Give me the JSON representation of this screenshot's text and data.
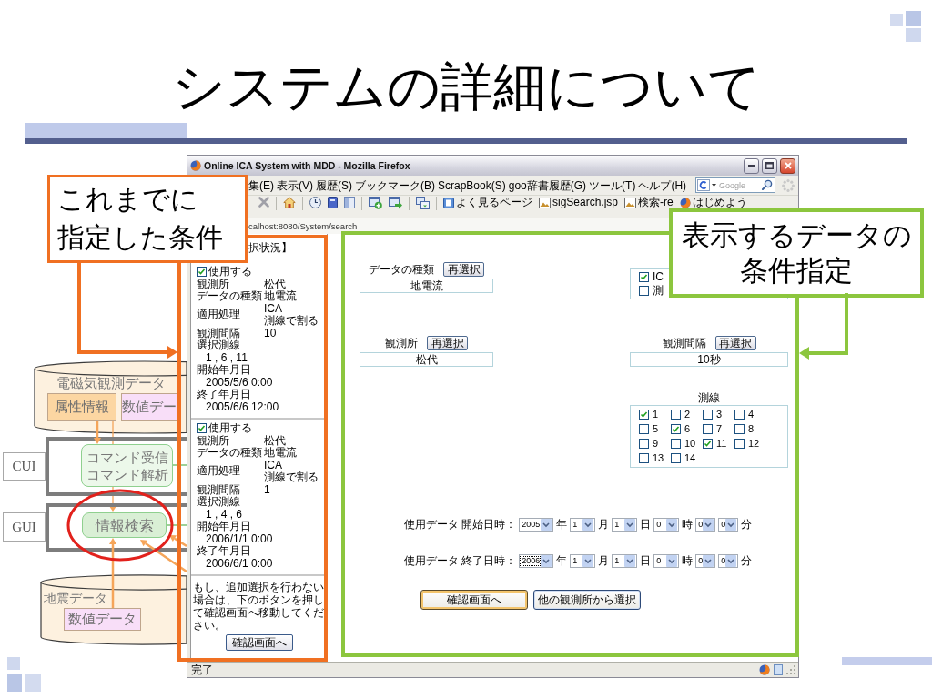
{
  "slide": {
    "title": "システムの詳細について"
  },
  "diagram": {
    "stores": [
      {
        "label": "電磁気観測データ",
        "blocks": [
          {
            "label": "属性情報",
            "color": "#fcd6a2"
          },
          {
            "label": "数値デー",
            "color": "#f8def8"
          }
        ]
      },
      {
        "label": "地震データ",
        "blocks": [
          {
            "label": "数値データ",
            "color": "#f8def8"
          }
        ]
      }
    ],
    "layers": [
      {
        "label": "CUI",
        "module": "コマンド受信コマンド解析",
        "circled": false
      },
      {
        "label": "GUI",
        "module": "情報検索",
        "circled": true
      }
    ]
  },
  "browser": {
    "title": "Online ICA System with MDD - Mozilla Firefox",
    "menu": [
      "集(E)",
      "表示(V)",
      "履歴(S)",
      "ブックマーク(B)",
      "ScrapBook(S)",
      "goo辞書履歴(G)",
      "ツール(T)",
      "ヘルプ(H)"
    ],
    "search": {
      "placeholder": "Google"
    },
    "bookmarks": [
      {
        "label": "よく見るページ",
        "kind": "page"
      },
      {
        "label": "sigSearch.jsp",
        "kind": "image"
      },
      {
        "label": "検索-re",
        "kind": "image"
      },
      {
        "label": "はじめよう",
        "kind": "globe"
      }
    ],
    "address": "calhost:8080/System/search",
    "status": "完了"
  },
  "selection_panel": {
    "header": "択状況】",
    "entries": [
      {
        "use_label": "使用する",
        "checked": true,
        "fields": [
          {
            "kind": "inline",
            "label": "観測所",
            "values": [
              "松代"
            ]
          },
          {
            "kind": "inline",
            "label": "データの種類",
            "values": [
              "地電流"
            ]
          },
          {
            "kind": "inline",
            "label": "適用処理",
            "values": [
              "ICA",
              "測線で割る"
            ]
          },
          {
            "kind": "inline",
            "label": "観測間隔",
            "values": [
              "10"
            ]
          },
          {
            "kind": "stacked",
            "label": "選択測線",
            "values": [
              "1 , 6 , 11"
            ]
          },
          {
            "kind": "stacked",
            "label": "開始年月日",
            "values": [
              "2005/5/6 0:00"
            ]
          },
          {
            "kind": "stacked",
            "label": "終了年月日",
            "values": [
              "2005/6/6 12:00"
            ]
          }
        ]
      },
      {
        "use_label": "使用する",
        "checked": true,
        "fields": [
          {
            "kind": "inline",
            "label": "観測所",
            "values": [
              "松代"
            ]
          },
          {
            "kind": "inline",
            "label": "データの種類",
            "values": [
              "地電流"
            ]
          },
          {
            "kind": "inline",
            "label": "適用処理",
            "values": [
              "ICA",
              "測線で割る"
            ]
          },
          {
            "kind": "inline",
            "label": "観測間隔",
            "values": [
              "1"
            ]
          },
          {
            "kind": "stacked",
            "label": "選択測線",
            "values": [
              "1 , 4 , 6"
            ]
          },
          {
            "kind": "stacked",
            "label": "開始年月日",
            "values": [
              "2006/1/1 0:00"
            ]
          },
          {
            "kind": "stacked",
            "label": "終了年月日",
            "values": [
              "2006/6/1 0:00"
            ]
          }
        ]
      }
    ],
    "note": "もし、追加選択を行わない場合は、下のボタンを押して確認画面へ移動してください。",
    "button": "確認画面へ"
  },
  "search_form": {
    "rows": [
      [
        {
          "kind": "field",
          "label": "データの種類",
          "button": "再選択",
          "value": "地電流"
        },
        {
          "kind": "checklist",
          "items": [
            {
              "label": "IC",
              "checked": true
            },
            {
              "label": "測",
              "checked": false
            }
          ]
        }
      ],
      [
        {
          "kind": "field",
          "label": "観測所",
          "button": "再選択",
          "value": "松代"
        },
        {
          "kind": "field",
          "label": "観測間隔",
          "button": "再選択",
          "value": "10秒"
        }
      ]
    ],
    "lines": {
      "label": "測線",
      "items": [
        {
          "label": "1",
          "checked": true
        },
        {
          "label": "2",
          "checked": false
        },
        {
          "label": "3",
          "checked": false
        },
        {
          "label": "4",
          "checked": false
        },
        {
          "label": "5",
          "checked": false
        },
        {
          "label": "6",
          "checked": true
        },
        {
          "label": "7",
          "checked": false
        },
        {
          "label": "8",
          "checked": false
        },
        {
          "label": "9",
          "checked": false
        },
        {
          "label": "10",
          "checked": false
        },
        {
          "label": "11",
          "checked": true
        },
        {
          "label": "12",
          "checked": false
        },
        {
          "label": "13",
          "checked": false
        },
        {
          "label": "14",
          "checked": false
        }
      ]
    },
    "dates": [
      {
        "label": "使用データ 開始日時：",
        "parts": [
          {
            "value": "2005",
            "unit": "年",
            "focused": false
          },
          {
            "value": "1",
            "unit": "月",
            "focused": false
          },
          {
            "value": "1",
            "unit": "日",
            "focused": false
          },
          {
            "value": "0",
            "unit": "時",
            "focused": false
          },
          {
            "value": "0",
            "focused": false
          },
          {
            "value": "0",
            "unit": "分",
            "focused": false
          }
        ]
      },
      {
        "label": "使用データ 終了日時：",
        "parts": [
          {
            "value": "2006",
            "unit": "年",
            "focused": true
          },
          {
            "value": "1",
            "unit": "月",
            "focused": false
          },
          {
            "value": "1",
            "unit": "日",
            "focused": false
          },
          {
            "value": "0",
            "unit": "時",
            "focused": false
          },
          {
            "value": "0",
            "focused": false
          },
          {
            "value": "0",
            "unit": "分",
            "focused": false
          }
        ]
      }
    ],
    "buttons": [
      {
        "label": "確認画面へ",
        "default": true
      },
      {
        "label": "他の観測所から選択",
        "default": false
      }
    ]
  },
  "callouts": [
    {
      "lines": [
        "これまでに",
        "指定した条件"
      ],
      "color": "#f07022"
    },
    {
      "lines": [
        "表示するデータの",
        "条件指定"
      ],
      "color": "#8cc63e"
    }
  ]
}
